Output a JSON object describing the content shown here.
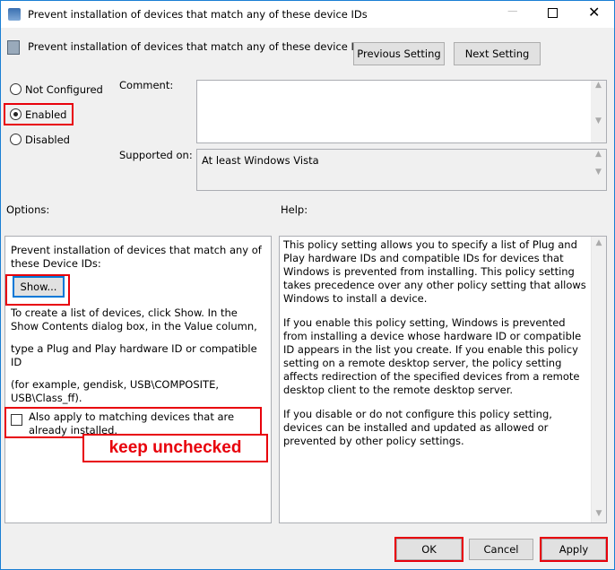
{
  "window": {
    "title": "Prevent installation of devices that match any of these device IDs"
  },
  "header": {
    "title": "Prevent installation of devices that match any of these device IDs",
    "previous": "Previous Setting",
    "next": "Next Setting"
  },
  "state": {
    "options": [
      "Not Configured",
      "Enabled",
      "Disabled"
    ],
    "selected": "Enabled"
  },
  "comment": {
    "label": "Comment:",
    "value": ""
  },
  "supported": {
    "label": "Supported on:",
    "value": "At least Windows Vista"
  },
  "options": {
    "label": "Options:",
    "intro": "Prevent installation of devices that match any of these Device IDs:",
    "show": "Show...",
    "p1": "To create a list of devices, click Show. In the Show Contents dialog box, in the Value column,",
    "p2": "type a Plug and Play hardware ID or compatible ID",
    "p3": "(for example, gendisk, USB\\COMPOSITE, USB\\Class_ff).",
    "checkbox": "Also apply to matching devices that are already installed.",
    "checked": false,
    "annotation": "keep unchecked"
  },
  "help": {
    "label": "Help:",
    "paragraphs": [
      "This policy setting allows you to specify a list of Plug and Play hardware IDs and compatible IDs for devices that Windows is prevented from installing. This policy setting takes precedence over any other policy setting that allows Windows to install a device.",
      "If you enable this policy setting, Windows is prevented from installing a device whose hardware ID or compatible ID appears in the list you create. If you enable this policy setting on a remote desktop server, the policy setting affects redirection of the specified devices from a remote desktop client to the remote desktop server.",
      "If you disable or do not configure this policy setting, devices can be installed and updated as allowed or prevented by other policy settings."
    ]
  },
  "footer": {
    "ok": "OK",
    "cancel": "Cancel",
    "apply": "Apply"
  },
  "colors": {
    "highlight": "#e8000b",
    "focus": "#0078d7"
  }
}
